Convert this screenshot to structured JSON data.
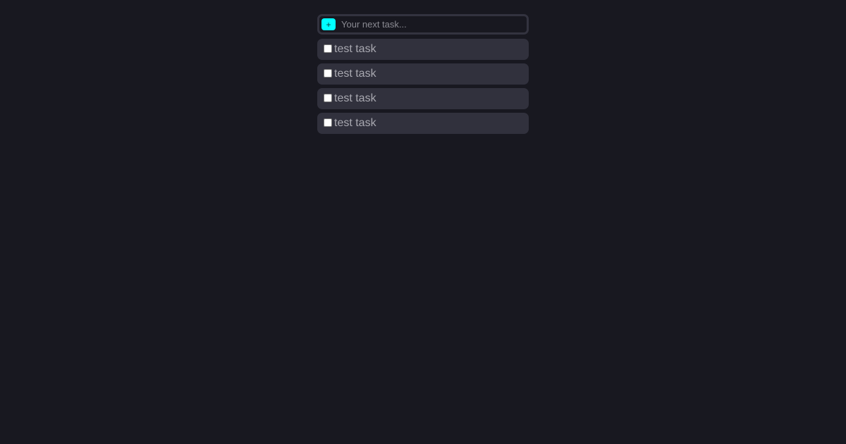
{
  "new_task": {
    "add_label": "+",
    "placeholder": "Your next task...",
    "value": ""
  },
  "tasks": [
    {
      "label": "test task",
      "done": false
    },
    {
      "label": "test task",
      "done": false
    },
    {
      "label": "test task",
      "done": false
    },
    {
      "label": "test task",
      "done": false
    }
  ],
  "colors": {
    "background": "#181820",
    "card": "#31313d",
    "accent": "#00ffff",
    "text": "#a8a8b0"
  }
}
